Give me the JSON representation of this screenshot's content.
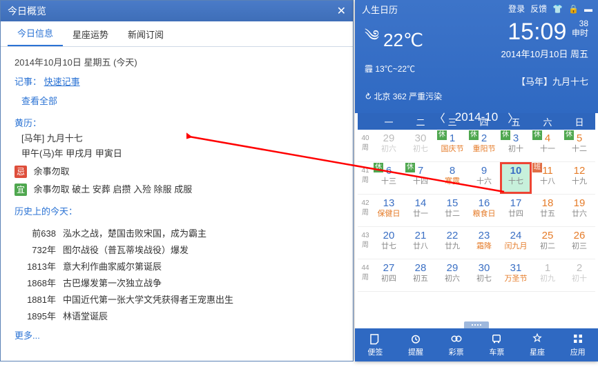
{
  "left": {
    "title": "今日概览",
    "tabs": [
      "今日信息",
      "星座运势",
      "新闻订阅"
    ],
    "date_line": "2014年10月10日 星期五 (今天)",
    "note_label": "记事：",
    "quick_note": "快速记事",
    "view_all": "查看全部",
    "huangli_label": "黄历：",
    "lunar_line1": "[马年] 九月十七",
    "lunar_line2": "甲午(马)年 甲戌月 甲寅日",
    "ji_badge": "忌",
    "ji_text": "余事勿取",
    "yi_badge": "宜",
    "yi_text": "余事勿取 破土 安葬 启攒 入殓 除服 成服",
    "history_label": "历史上的今天：",
    "history": [
      {
        "year": "前638",
        "text": "泓水之战，楚国击败宋国，成为霸主"
      },
      {
        "year": "732年",
        "text": "图尔战役（普瓦蒂埃战役）爆发"
      },
      {
        "year": "1813年",
        "text": "意大利作曲家威尔第诞辰"
      },
      {
        "year": "1868年",
        "text": "古巴爆发第一次独立战争"
      },
      {
        "year": "1881年",
        "text": "中国近代第一张大学文凭获得者王宠惠出生"
      },
      {
        "year": "1895年",
        "text": "林语堂诞辰"
      }
    ],
    "more": "更多..."
  },
  "right": {
    "brand": "人生日历",
    "topbar": {
      "login": "登录",
      "feedback": "反馈"
    },
    "weather": {
      "icon": "wind",
      "temp": "22℃",
      "cond": "霾",
      "range": "13℃~22℃"
    },
    "clock": {
      "time": "15:09",
      "sec": "38",
      "zhi": "申时"
    },
    "date_text": "2014年10月10日 周五",
    "lunar_text": "【马年】九月十七",
    "aqi": {
      "city": "北京",
      "value": "362",
      "level": "严重污染"
    },
    "month_nav": {
      "label": "2014-10"
    },
    "week_head": [
      "一",
      "二",
      "三",
      "四",
      "五",
      "六",
      "日"
    ],
    "rows": [
      {
        "wk": "40",
        "label": "周",
        "cells": [
          {
            "d": "29",
            "sub": "初六",
            "cls": "other"
          },
          {
            "d": "30",
            "sub": "初七",
            "cls": "other"
          },
          {
            "d": "1",
            "sub": "国庆节",
            "cls": " festival",
            "hol": "休"
          },
          {
            "d": "2",
            "sub": "重阳节",
            "cls": " festival",
            "hol": "休"
          },
          {
            "d": "3",
            "sub": "初十",
            "cls": "",
            "hol": "休"
          },
          {
            "d": "4",
            "sub": "十一",
            "cls": "wknd",
            "hol": "休"
          },
          {
            "d": "5",
            "sub": "十二",
            "cls": "wknd",
            "hol": "休"
          }
        ]
      },
      {
        "wk": "41",
        "label": "周",
        "cells": [
          {
            "d": "6",
            "sub": "十三",
            "cls": "",
            "hol": "休"
          },
          {
            "d": "7",
            "sub": "十四",
            "cls": "",
            "hol": "休"
          },
          {
            "d": "8",
            "sub": "寒露",
            "cls": " festival"
          },
          {
            "d": "9",
            "sub": "十六",
            "cls": ""
          },
          {
            "d": "10",
            "sub": "十七",
            "cls": "today"
          },
          {
            "d": "11",
            "sub": "十八",
            "cls": "wknd ban",
            "hol": "班"
          },
          {
            "d": "12",
            "sub": "十九",
            "cls": "wknd"
          }
        ]
      },
      {
        "wk": "42",
        "label": "周",
        "cells": [
          {
            "d": "13",
            "sub": "保健日",
            "cls": " festival"
          },
          {
            "d": "14",
            "sub": "廿一",
            "cls": ""
          },
          {
            "d": "15",
            "sub": "廿二",
            "cls": ""
          },
          {
            "d": "16",
            "sub": "粮食日",
            "cls": " festival"
          },
          {
            "d": "17",
            "sub": "廿四",
            "cls": ""
          },
          {
            "d": "18",
            "sub": "廿五",
            "cls": "wknd"
          },
          {
            "d": "19",
            "sub": "廿六",
            "cls": "wknd"
          }
        ]
      },
      {
        "wk": "43",
        "label": "周",
        "cells": [
          {
            "d": "20",
            "sub": "廿七",
            "cls": ""
          },
          {
            "d": "21",
            "sub": "廿八",
            "cls": ""
          },
          {
            "d": "22",
            "sub": "廿九",
            "cls": ""
          },
          {
            "d": "23",
            "sub": "霜降",
            "cls": " festival"
          },
          {
            "d": "24",
            "sub": "闰九月",
            "cls": " festival"
          },
          {
            "d": "25",
            "sub": "初二",
            "cls": "wknd"
          },
          {
            "d": "26",
            "sub": "初三",
            "cls": "wknd"
          }
        ]
      },
      {
        "wk": "44",
        "label": "周",
        "cells": [
          {
            "d": "27",
            "sub": "初四",
            "cls": ""
          },
          {
            "d": "28",
            "sub": "初五",
            "cls": ""
          },
          {
            "d": "29",
            "sub": "初六",
            "cls": ""
          },
          {
            "d": "30",
            "sub": "初七",
            "cls": ""
          },
          {
            "d": "31",
            "sub": "万圣节",
            "cls": " festival"
          },
          {
            "d": "1",
            "sub": "初九",
            "cls": "other"
          },
          {
            "d": "2",
            "sub": "初十",
            "cls": "other"
          }
        ]
      }
    ],
    "tools": [
      {
        "name": "便签",
        "icon": "note"
      },
      {
        "name": "提醒",
        "icon": "alarm"
      },
      {
        "name": "彩票",
        "icon": "lottery"
      },
      {
        "name": "车票",
        "icon": "bus"
      },
      {
        "name": "星座",
        "icon": "star"
      },
      {
        "name": "应用",
        "icon": "apps"
      }
    ]
  }
}
